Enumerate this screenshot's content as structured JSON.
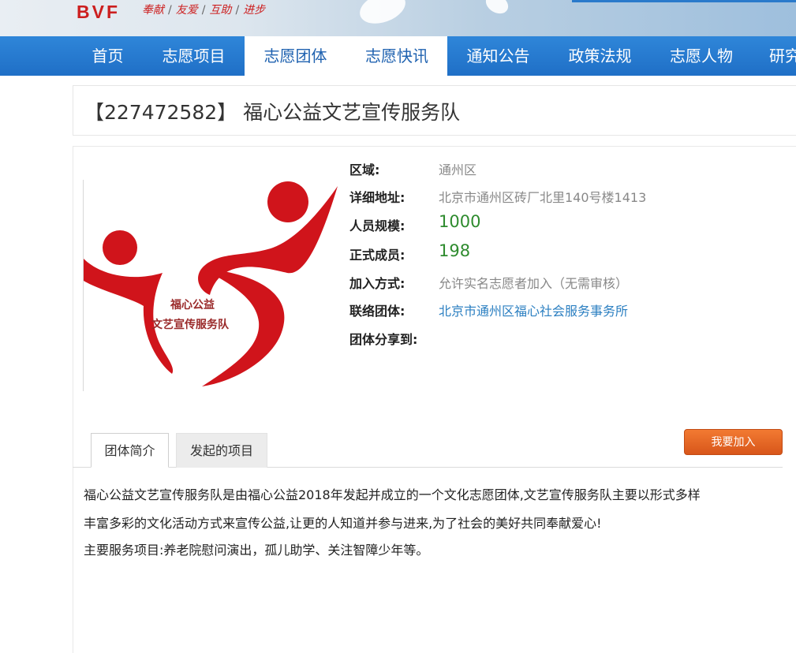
{
  "banner": {
    "logo": "BVF",
    "slogan": [
      "奉献",
      "友爱",
      "互助",
      "进步"
    ],
    "slogan_separator": "/"
  },
  "nav": {
    "items": [
      {
        "label": "首页",
        "active": false
      },
      {
        "label": "志愿项目",
        "active": false
      },
      {
        "label": "志愿团体",
        "active": true
      },
      {
        "label": "志愿快讯",
        "active": false
      },
      {
        "label": "通知公告",
        "active": false
      },
      {
        "label": "政策法规",
        "active": false
      },
      {
        "label": "志愿人物",
        "active": false
      },
      {
        "label": "研究",
        "active": false
      }
    ]
  },
  "group": {
    "title": "【227472582】 福心公益文艺宣传服务队",
    "logo_text_line1": "福心公益",
    "logo_text_line2": "文艺宣传服务队",
    "info": [
      {
        "label": "区域:",
        "value": "通州区"
      },
      {
        "label": "详细地址:",
        "value": "北京市通州区砖厂北里140号楼1413"
      },
      {
        "label": "人员规模:",
        "value": "1000"
      },
      {
        "label": "正式成员:",
        "value": "198"
      },
      {
        "label": "加入方式:",
        "value": "允许实名志愿者加入（无需审核）"
      },
      {
        "label": "联络团体:",
        "value": "北京市通州区福心社会服务事务所"
      },
      {
        "label": "团体分享到:",
        "value": ""
      }
    ]
  },
  "tabs": [
    {
      "label": "团体简介",
      "active": true
    },
    {
      "label": "发起的项目",
      "active": false
    }
  ],
  "join_button": "我要加入",
  "description": {
    "lines": [
      "福心公益文艺宣传服务队是由福心公益2018年发起并成立的一个文化志愿团体,文艺宣传服务队主要以形式多样",
      "丰富多彩的文化活动方式来宣传公益,让更的人知道并参与进来,为了社会的美好共同奉献爱心!",
      "主要服务项目:养老院慰问演出，孤儿助学、关注智障少年等。"
    ]
  },
  "colors": {
    "nav_bg": "#1f6fc6",
    "accent_red": "#cc1f1f",
    "number_green": "#2e8b2e",
    "link_blue": "#2b7fc1",
    "button_orange": "#e2621f"
  }
}
